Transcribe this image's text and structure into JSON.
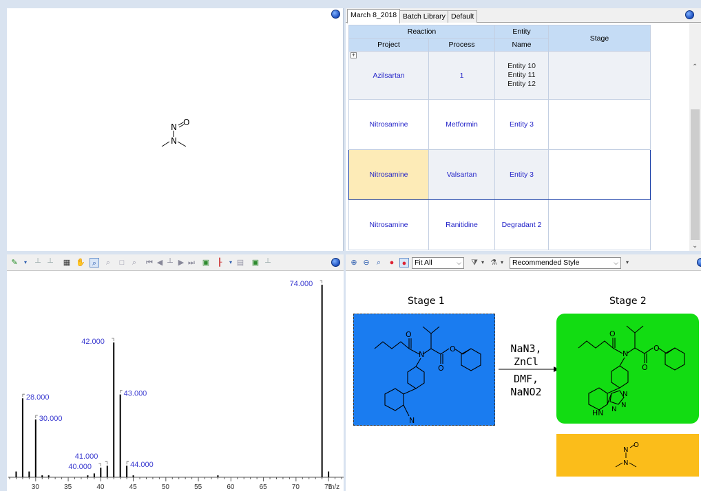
{
  "tabs": [
    {
      "label": "March 8_2018",
      "active": true
    },
    {
      "label": "Batch Library",
      "active": false
    },
    {
      "label": "Default",
      "active": false
    }
  ],
  "table": {
    "group_headers": {
      "reaction": "Reaction",
      "entity": "Entity",
      "stage": "Stage"
    },
    "sub_headers": {
      "project": "Project",
      "process": "Process",
      "name": "Name"
    },
    "rows": [
      {
        "project": "Azilsartan",
        "process": "1",
        "name": [
          "Entity 10",
          "Entity 11",
          "Entity 12"
        ],
        "stage": ""
      },
      {
        "project": "Nitrosamine",
        "process": "Metformin",
        "name": [
          "Entity 3"
        ],
        "stage": ""
      },
      {
        "project": "Nitrosamine",
        "process": "Valsartan",
        "name": [
          "Entity 3"
        ],
        "stage": ""
      },
      {
        "project": "Nitrosamine",
        "process": "Ranitidine",
        "name": [
          "Degradant 2"
        ],
        "stage": ""
      }
    ],
    "expand_glyph": "+"
  },
  "scheme_toolbar": {
    "zoom_select": "Fit All",
    "style_select": "Recommended Style"
  },
  "scheme": {
    "stage1_title": "Stage 1",
    "stage2_title": "Stage 2",
    "conditions": [
      "NaN3,",
      "ZnCl",
      "DMF,",
      "NaNO2"
    ],
    "stage1_color": "#1a7cf0",
    "stage2_color": "#12dc12",
    "byproduct_color": "#fbbd1a",
    "atom_labels": {
      "n": "N",
      "o": "O",
      "hn": "HN"
    }
  },
  "structure": {
    "atom_n1": "N",
    "atom_n2": "N",
    "atom_o": "O"
  },
  "chart_data": {
    "type": "bar",
    "xlabel": "m/z",
    "xlim": [
      26,
      77
    ],
    "ticks": [
      30,
      35,
      40,
      45,
      50,
      55,
      60,
      65,
      70,
      75
    ],
    "tick_labels": [
      "30",
      "35",
      "40",
      "45",
      "50",
      "55",
      "60",
      "65",
      "70",
      "75"
    ],
    "ylim": [
      0,
      100
    ],
    "peaks": [
      {
        "x": 27,
        "y": 3,
        "label": ""
      },
      {
        "x": 28,
        "y": 41,
        "label": "28.000"
      },
      {
        "x": 29,
        "y": 3,
        "label": ""
      },
      {
        "x": 30,
        "y": 30,
        "label": "30.000"
      },
      {
        "x": 31,
        "y": 1,
        "label": ""
      },
      {
        "x": 32,
        "y": 1,
        "label": ""
      },
      {
        "x": 38,
        "y": 1,
        "label": ""
      },
      {
        "x": 39,
        "y": 2,
        "label": ""
      },
      {
        "x": 40,
        "y": 5,
        "label": "40.000"
      },
      {
        "x": 41,
        "y": 6,
        "label": "41.000"
      },
      {
        "x": 42,
        "y": 70,
        "label": "42.000"
      },
      {
        "x": 43,
        "y": 43,
        "label": "43.000"
      },
      {
        "x": 44,
        "y": 6,
        "label": "44.000"
      },
      {
        "x": 45,
        "y": 1,
        "label": ""
      },
      {
        "x": 58,
        "y": 1,
        "label": ""
      },
      {
        "x": 74,
        "y": 100,
        "label": "74.000"
      },
      {
        "x": 75,
        "y": 3,
        "label": ""
      }
    ]
  }
}
